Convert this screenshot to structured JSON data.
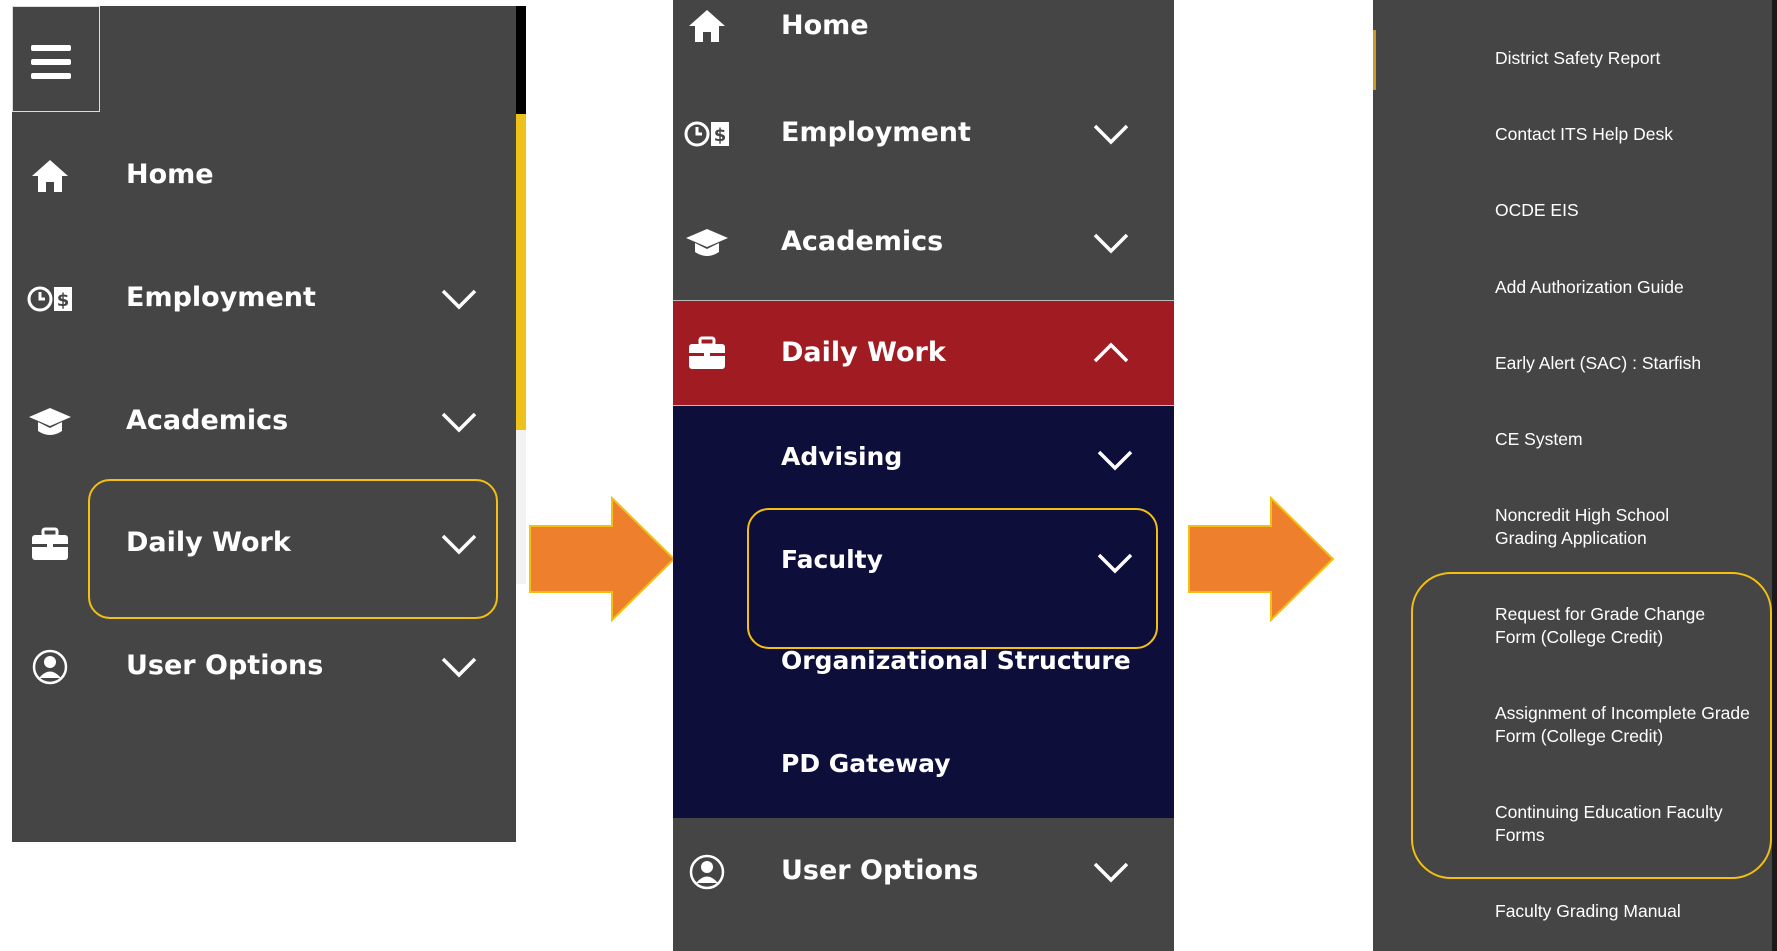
{
  "colors": {
    "panel_bg": "#454545",
    "active_bg": "#a01c22",
    "submenu_bg": "#0d0e3a",
    "highlight": "#f3c012",
    "arrow": "#ee7f2d",
    "text": "#ffffff"
  },
  "panel1": {
    "menu_icon": "hamburger-icon",
    "items": [
      {
        "label": "Home",
        "icon": "home-icon"
      },
      {
        "label": "Employment",
        "icon": "clock-dollar-icon"
      },
      {
        "label": "Academics",
        "icon": "graduation-cap-icon"
      },
      {
        "label": "Daily Work",
        "icon": "briefcase-icon"
      },
      {
        "label": "User Options",
        "icon": "user-circle-icon"
      }
    ]
  },
  "panel2": {
    "items": [
      {
        "label": "Home",
        "icon": "home-icon"
      },
      {
        "label": "Employment",
        "icon": "clock-dollar-icon"
      },
      {
        "label": "Academics",
        "icon": "graduation-cap-icon"
      },
      {
        "label": "Daily Work",
        "icon": "briefcase-icon",
        "expanded": true
      },
      {
        "label": "User Options",
        "icon": "user-circle-icon"
      }
    ],
    "submenu": [
      {
        "label": "Advising",
        "has_children": true
      },
      {
        "label": "Faculty",
        "has_children": true
      },
      {
        "label": "Organizational Structure",
        "has_children": false
      },
      {
        "label": "PD Gateway",
        "has_children": false
      }
    ]
  },
  "panel3": {
    "links": [
      "District Safety Report",
      "Contact ITS Help Desk",
      "OCDE EIS",
      "Add Authorization Guide",
      "Early Alert (SAC) : Starfish",
      "CE System",
      "Noncredit High School Grading Application",
      "Request for Grade Change Form (College Credit)",
      "Assignment of Incomplete Grade Form (College Credit)",
      "Continuing Education Faculty Forms",
      "Faculty Grading Manual"
    ]
  }
}
